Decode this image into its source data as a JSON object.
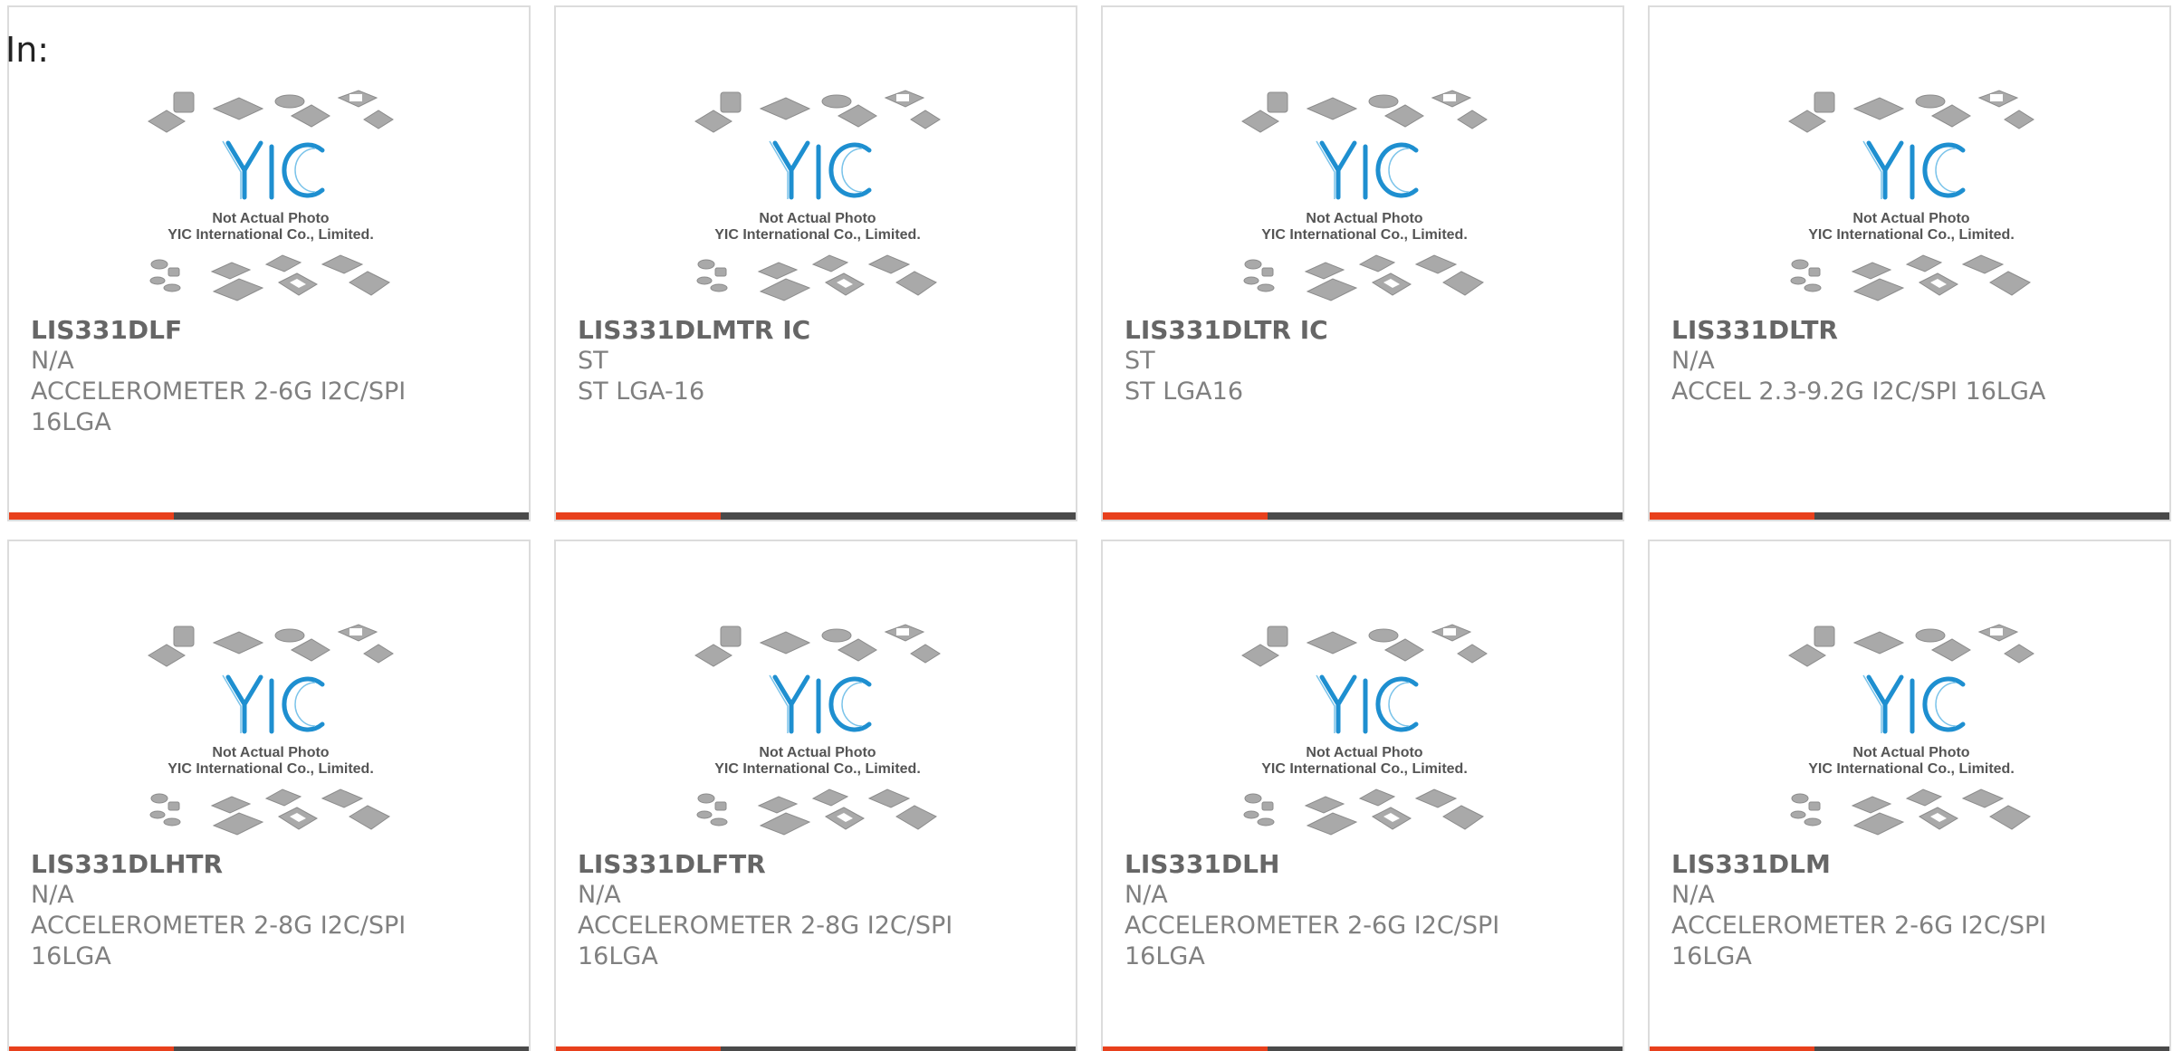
{
  "header": {
    "label": "In:"
  },
  "colors": {
    "accent": "#e8401c",
    "bar": "#4a4a4a",
    "logo_blue": "#1e8fd0"
  },
  "placeholder": {
    "icon": "chip-packages-icon",
    "caption_line1": "Not Actual Photo",
    "caption_line2": "YIC International Co., Limited."
  },
  "products": [
    {
      "part": "LIS331DLF",
      "manufacturer": "N/A",
      "desc1": "ACCELEROMETER 2-6G I2C/SPI",
      "desc2": "16LGA"
    },
    {
      "part": "LIS331DLMTR IC",
      "manufacturer": "ST",
      "desc1": "ST LGA-16",
      "desc2": ""
    },
    {
      "part": "LIS331DLTR IC",
      "manufacturer": "ST",
      "desc1": "ST LGA16",
      "desc2": ""
    },
    {
      "part": "LIS331DLTR",
      "manufacturer": "N/A",
      "desc1": "ACCEL 2.3-9.2G I2C/SPI 16LGA",
      "desc2": ""
    },
    {
      "part": "LIS331DLHTR",
      "manufacturer": "N/A",
      "desc1": "ACCELEROMETER 2-8G I2C/SPI",
      "desc2": "16LGA"
    },
    {
      "part": "LIS331DLFTR",
      "manufacturer": "N/A",
      "desc1": "ACCELEROMETER 2-8G I2C/SPI",
      "desc2": "16LGA"
    },
    {
      "part": "LIS331DLH",
      "manufacturer": "N/A",
      "desc1": "ACCELEROMETER 2-6G I2C/SPI",
      "desc2": "16LGA"
    },
    {
      "part": "LIS331DLM",
      "manufacturer": "N/A",
      "desc1": "ACCELEROMETER 2-6G I2C/SPI",
      "desc2": "16LGA"
    }
  ]
}
